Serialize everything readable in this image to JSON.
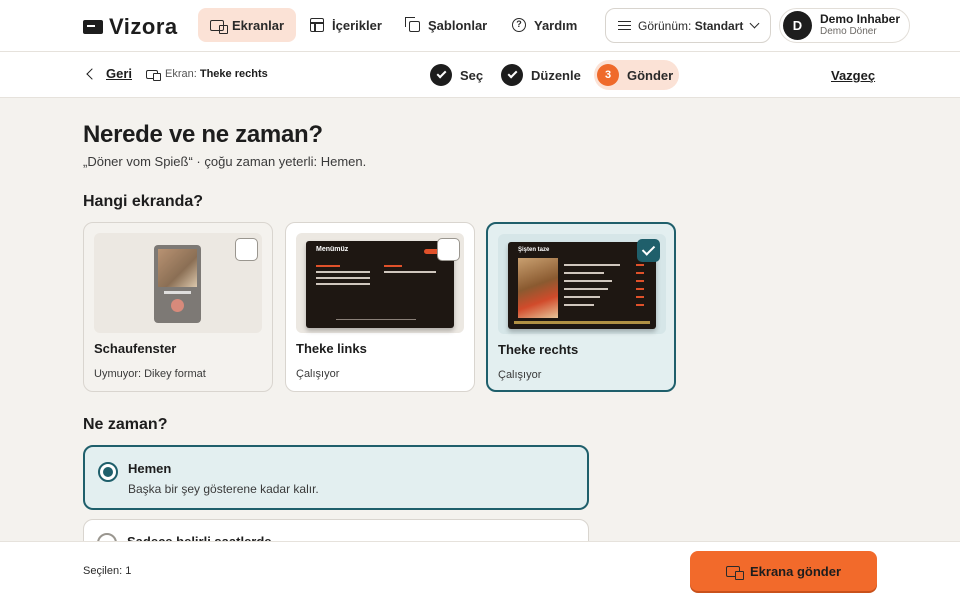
{
  "app": {
    "logo": "Vizora"
  },
  "nav": {
    "items": [
      {
        "label": "Ekranlar",
        "icon": "screen-icon",
        "active": true
      },
      {
        "label": "İçerikler",
        "icon": "table-icon",
        "active": false
      },
      {
        "label": "Şablonlar",
        "icon": "copy-icon",
        "active": false
      },
      {
        "label": "Yardım",
        "icon": "help-icon",
        "active": false
      }
    ],
    "view_prefix": "Görünüm:",
    "view_value": "Standart",
    "user": {
      "initial": "D",
      "name": "Demo Inhaber",
      "business": "Demo Döner"
    }
  },
  "subbar": {
    "back_label": "Geri",
    "crumb_prefix": "Ekran:",
    "crumb_value": "Theke rechts",
    "steps": [
      {
        "label": "Seç",
        "state": "done"
      },
      {
        "label": "Düzenle",
        "state": "done"
      },
      {
        "label": "Gönder",
        "state": "current",
        "number": "3"
      }
    ],
    "cancel_label": "Vazgeç"
  },
  "main": {
    "title": "Nerede ve ne zaman?",
    "subtitle": "„Döner vom Spieß“ · çoğu zaman yeterli: Hemen.",
    "screens_heading": "Hangi ekranda?",
    "screens": [
      {
        "name": "Schaufenster",
        "status": "Uymuyor: Dikey format",
        "selected": false
      },
      {
        "name": "Theke links",
        "status": "Çalışıyor",
        "selected": false,
        "preview_title": "Menümüz"
      },
      {
        "name": "Theke rechts",
        "status": "Çalışıyor",
        "selected": true,
        "preview_title": "Şişten taze"
      }
    ],
    "when_heading": "Ne zaman?",
    "options": [
      {
        "title": "Hemen",
        "desc": "Başka bir şey gösterene kadar kalır.",
        "selected": true
      },
      {
        "title": "Sadece belirli saatlerde",
        "selected": false
      }
    ]
  },
  "footer": {
    "selected_count": "Seçilen: 1",
    "send_label": "Ekrana gönder"
  },
  "colors": {
    "accent": "#f26a2b",
    "selected": "#1f5f6b",
    "selected_bg": "#e3eff0",
    "active_nav": "#fbe2d6"
  }
}
